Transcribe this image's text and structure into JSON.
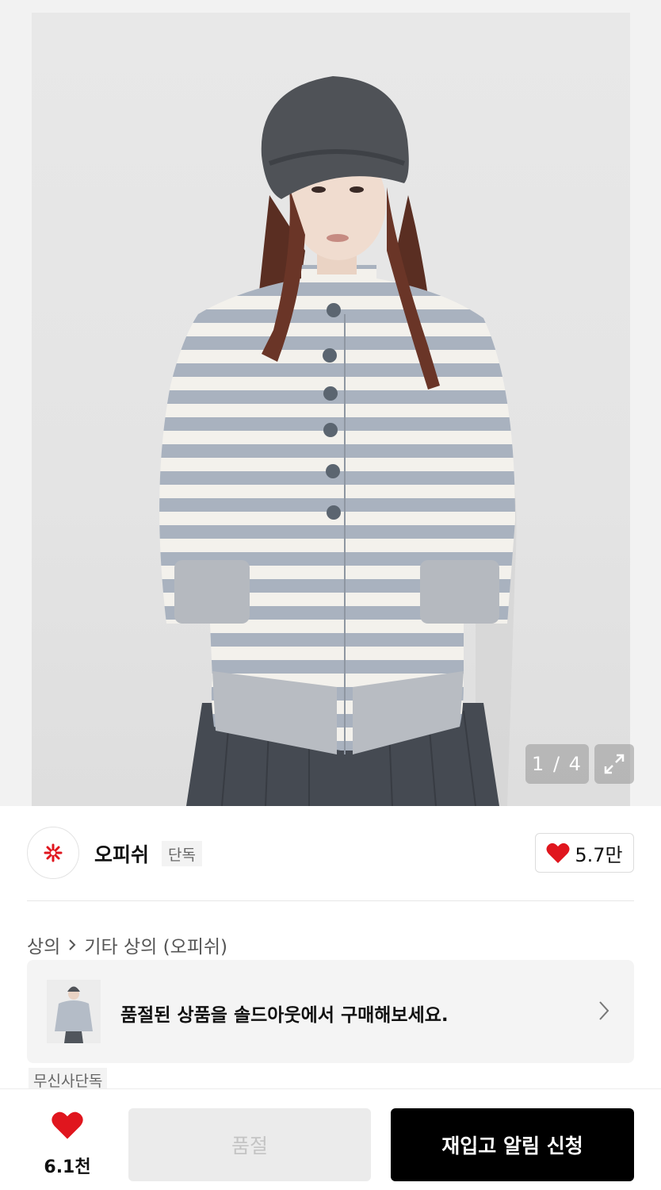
{
  "product_image": {
    "counter": "1 / 4",
    "icon": "expand-icon"
  },
  "brand": {
    "name": "오피쉬",
    "tag": "단독",
    "logo_icon": "flower-logo-icon",
    "like_count": "5.7만",
    "accent": "#e0161e"
  },
  "breadcrumb": {
    "category": "상의",
    "subcategory": "기타 상의 (오피쉬)"
  },
  "soldout_banner": {
    "text": "품절된 상품을 솔드아웃에서 구매해보세요.",
    "icon": "chevron-right-icon"
  },
  "badge": {
    "label": "무신사단독"
  },
  "bottom_bar": {
    "wish_count": "6.1천",
    "soldout_label": "품절",
    "restock_label": "재입고 알림 신청"
  }
}
